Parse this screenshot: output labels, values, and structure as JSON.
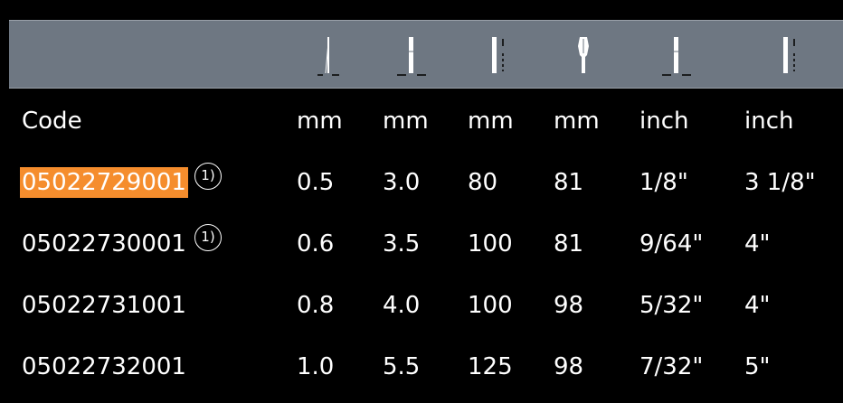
{
  "colors": {
    "header_background": "#6e7782",
    "highlight": "#f58d2d",
    "page_background": "#000000",
    "text": "#ffffff"
  },
  "header_icons": [
    {
      "name": "blade-width-icon"
    },
    {
      "name": "blade-thickness-icon"
    },
    {
      "name": "blade-length-icon"
    },
    {
      "name": "total-length-icon"
    },
    {
      "name": "blade-thickness-inch-icon"
    },
    {
      "name": "blade-length-inch-icon"
    }
  ],
  "table": {
    "units": [
      "Code",
      "mm",
      "mm",
      "mm",
      "mm",
      "inch",
      "inch"
    ],
    "rows": [
      {
        "code": "05022729001",
        "note": "1)",
        "cols": [
          "0.5",
          "3.0",
          "80",
          "81",
          "1/8\"",
          "3 1/8\""
        ]
      },
      {
        "code": "05022730001",
        "note": "1)",
        "cols": [
          "0.6",
          "3.5",
          "100",
          "81",
          "9/64\"",
          "4\""
        ]
      },
      {
        "code": "05022731001",
        "note": "",
        "cols": [
          "0.8",
          "4.0",
          "100",
          "98",
          "5/32\"",
          "4\""
        ]
      },
      {
        "code": "05022732001",
        "note": "",
        "cols": [
          "1.0",
          "5.5",
          "125",
          "98",
          "7/32\"",
          "5\""
        ]
      }
    ]
  }
}
